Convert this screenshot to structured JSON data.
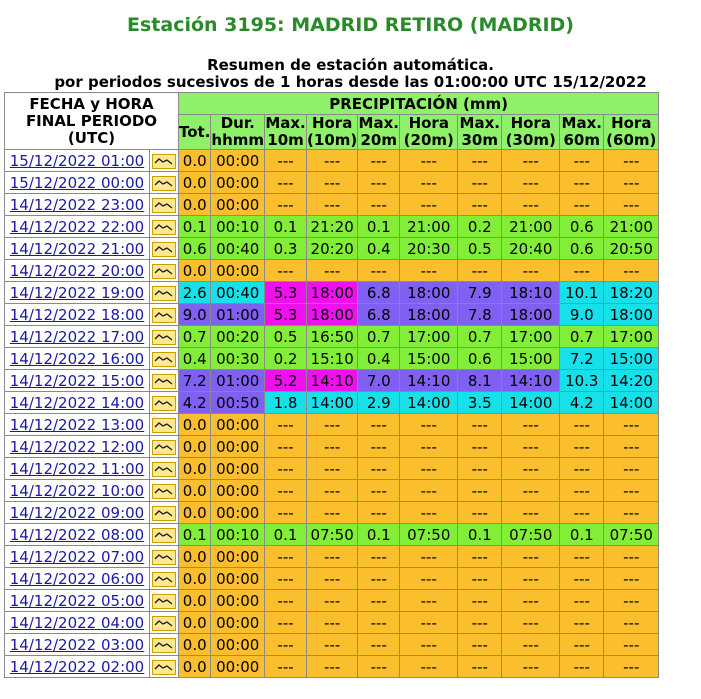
{
  "title": "Estación 3195: MADRID RETIRO (MADRID)",
  "subtitle1": "Resumen de estación automática.",
  "subtitle2": "por periodos sucesivos de 1 horas desde las 01:00:00 UTC 15/12/2022",
  "headers": {
    "fecha": "FECHA y HORA FINAL PERIODO (UTC)",
    "precip": "PRECIPITACIÓN (mm)",
    "cols": [
      "Tot.",
      "Dur. hhmm",
      "Max. 10m",
      "Hora (10m)",
      "Max. 20m",
      "Hora (20m)",
      "Max. 30m",
      "Hora (30m)",
      "Max. 60m",
      "Hora (60m)"
    ]
  },
  "icon": "graph-icon",
  "colors": {
    "orange": "#fbbf2e",
    "green": "#82ee38",
    "cyan": "#17e0e8",
    "blue": "#8060f0",
    "magenta": "#ee11ee",
    "header": "#8ff06a",
    "title": "#2a8a2a"
  },
  "rows": [
    {
      "date": "15/12/2022 01:00",
      "v": [
        "0.0",
        "00:00",
        "---",
        "---",
        "---",
        "---",
        "---",
        "---",
        "---",
        "---"
      ],
      "c": [
        "or",
        "or",
        "or",
        "or",
        "or",
        "or",
        "or",
        "or",
        "or",
        "or"
      ]
    },
    {
      "date": "15/12/2022 00:00",
      "v": [
        "0.0",
        "00:00",
        "---",
        "---",
        "---",
        "---",
        "---",
        "---",
        "---",
        "---"
      ],
      "c": [
        "or",
        "or",
        "or",
        "or",
        "or",
        "or",
        "or",
        "or",
        "or",
        "or"
      ]
    },
    {
      "date": "14/12/2022 23:00",
      "v": [
        "0.0",
        "00:00",
        "---",
        "---",
        "---",
        "---",
        "---",
        "---",
        "---",
        "---"
      ],
      "c": [
        "or",
        "or",
        "or",
        "or",
        "or",
        "or",
        "or",
        "or",
        "or",
        "or"
      ]
    },
    {
      "date": "14/12/2022 22:00",
      "v": [
        "0.1",
        "00:10",
        "0.1",
        "21:20",
        "0.1",
        "21:00",
        "0.2",
        "21:00",
        "0.6",
        "21:00"
      ],
      "c": [
        "gr",
        "gr",
        "gr",
        "gr",
        "gr",
        "gr",
        "gr",
        "gr",
        "gr",
        "gr"
      ]
    },
    {
      "date": "14/12/2022 21:00",
      "v": [
        "0.6",
        "00:40",
        "0.3",
        "20:20",
        "0.4",
        "20:30",
        "0.5",
        "20:40",
        "0.6",
        "20:50"
      ],
      "c": [
        "gr",
        "gr",
        "gr",
        "gr",
        "gr",
        "gr",
        "gr",
        "gr",
        "gr",
        "gr"
      ]
    },
    {
      "date": "14/12/2022 20:00",
      "v": [
        "0.0",
        "00:00",
        "---",
        "---",
        "---",
        "---",
        "---",
        "---",
        "---",
        "---"
      ],
      "c": [
        "or",
        "or",
        "or",
        "or",
        "or",
        "or",
        "or",
        "or",
        "or",
        "or"
      ]
    },
    {
      "date": "14/12/2022 19:00",
      "v": [
        "2.6",
        "00:40",
        "5.3",
        "18:00",
        "6.8",
        "18:00",
        "7.9",
        "18:10",
        "10.1",
        "18:20"
      ],
      "c": [
        "cy",
        "cy",
        "mg",
        "mg",
        "bl",
        "bl",
        "bl",
        "bl",
        "cy",
        "cy"
      ]
    },
    {
      "date": "14/12/2022 18:00",
      "v": [
        "9.0",
        "01:00",
        "5.3",
        "18:00",
        "6.8",
        "18:00",
        "7.8",
        "18:00",
        "9.0",
        "18:00"
      ],
      "c": [
        "bl",
        "bl",
        "mg",
        "mg",
        "bl",
        "bl",
        "bl",
        "bl",
        "cy",
        "cy"
      ]
    },
    {
      "date": "14/12/2022 17:00",
      "v": [
        "0.7",
        "00:20",
        "0.5",
        "16:50",
        "0.7",
        "17:00",
        "0.7",
        "17:00",
        "0.7",
        "17:00"
      ],
      "c": [
        "gr",
        "gr",
        "gr",
        "gr",
        "gr",
        "gr",
        "gr",
        "gr",
        "gr",
        "gr"
      ]
    },
    {
      "date": "14/12/2022 16:00",
      "v": [
        "0.4",
        "00:30",
        "0.2",
        "15:10",
        "0.4",
        "15:00",
        "0.6",
        "15:00",
        "7.2",
        "15:00"
      ],
      "c": [
        "gr",
        "gr",
        "gr",
        "gr",
        "gr",
        "gr",
        "gr",
        "gr",
        "cy",
        "cy"
      ]
    },
    {
      "date": "14/12/2022 15:00",
      "v": [
        "7.2",
        "01:00",
        "5.2",
        "14:10",
        "7.0",
        "14:10",
        "8.1",
        "14:10",
        "10.3",
        "14:20"
      ],
      "c": [
        "bl",
        "bl",
        "mg",
        "mg",
        "bl",
        "bl",
        "bl",
        "bl",
        "cy",
        "cy"
      ]
    },
    {
      "date": "14/12/2022 14:00",
      "v": [
        "4.2",
        "00:50",
        "1.8",
        "14:00",
        "2.9",
        "14:00",
        "3.5",
        "14:00",
        "4.2",
        "14:00"
      ],
      "c": [
        "bl",
        "bl",
        "cy",
        "cy",
        "cy",
        "cy",
        "cy",
        "cy",
        "cy",
        "cy"
      ]
    },
    {
      "date": "14/12/2022 13:00",
      "v": [
        "0.0",
        "00:00",
        "---",
        "---",
        "---",
        "---",
        "---",
        "---",
        "---",
        "---"
      ],
      "c": [
        "or",
        "or",
        "or",
        "or",
        "or",
        "or",
        "or",
        "or",
        "or",
        "or"
      ]
    },
    {
      "date": "14/12/2022 12:00",
      "v": [
        "0.0",
        "00:00",
        "---",
        "---",
        "---",
        "---",
        "---",
        "---",
        "---",
        "---"
      ],
      "c": [
        "or",
        "or",
        "or",
        "or",
        "or",
        "or",
        "or",
        "or",
        "or",
        "or"
      ]
    },
    {
      "date": "14/12/2022 11:00",
      "v": [
        "0.0",
        "00:00",
        "---",
        "---",
        "---",
        "---",
        "---",
        "---",
        "---",
        "---"
      ],
      "c": [
        "or",
        "or",
        "or",
        "or",
        "or",
        "or",
        "or",
        "or",
        "or",
        "or"
      ]
    },
    {
      "date": "14/12/2022 10:00",
      "v": [
        "0.0",
        "00:00",
        "---",
        "---",
        "---",
        "---",
        "---",
        "---",
        "---",
        "---"
      ],
      "c": [
        "or",
        "or",
        "or",
        "or",
        "or",
        "or",
        "or",
        "or",
        "or",
        "or"
      ]
    },
    {
      "date": "14/12/2022 09:00",
      "v": [
        "0.0",
        "00:00",
        "---",
        "---",
        "---",
        "---",
        "---",
        "---",
        "---",
        "---"
      ],
      "c": [
        "or",
        "or",
        "or",
        "or",
        "or",
        "or",
        "or",
        "or",
        "or",
        "or"
      ]
    },
    {
      "date": "14/12/2022 08:00",
      "v": [
        "0.1",
        "00:10",
        "0.1",
        "07:50",
        "0.1",
        "07:50",
        "0.1",
        "07:50",
        "0.1",
        "07:50"
      ],
      "c": [
        "gr",
        "gr",
        "gr",
        "gr",
        "gr",
        "gr",
        "gr",
        "gr",
        "gr",
        "gr"
      ]
    },
    {
      "date": "14/12/2022 07:00",
      "v": [
        "0.0",
        "00:00",
        "---",
        "---",
        "---",
        "---",
        "---",
        "---",
        "---",
        "---"
      ],
      "c": [
        "or",
        "or",
        "or",
        "or",
        "or",
        "or",
        "or",
        "or",
        "or",
        "or"
      ]
    },
    {
      "date": "14/12/2022 06:00",
      "v": [
        "0.0",
        "00:00",
        "---",
        "---",
        "---",
        "---",
        "---",
        "---",
        "---",
        "---"
      ],
      "c": [
        "or",
        "or",
        "or",
        "or",
        "or",
        "or",
        "or",
        "or",
        "or",
        "or"
      ]
    },
    {
      "date": "14/12/2022 05:00",
      "v": [
        "0.0",
        "00:00",
        "---",
        "---",
        "---",
        "---",
        "---",
        "---",
        "---",
        "---"
      ],
      "c": [
        "or",
        "or",
        "or",
        "or",
        "or",
        "or",
        "or",
        "or",
        "or",
        "or"
      ]
    },
    {
      "date": "14/12/2022 04:00",
      "v": [
        "0.0",
        "00:00",
        "---",
        "---",
        "---",
        "---",
        "---",
        "---",
        "---",
        "---"
      ],
      "c": [
        "or",
        "or",
        "or",
        "or",
        "or",
        "or",
        "or",
        "or",
        "or",
        "or"
      ]
    },
    {
      "date": "14/12/2022 03:00",
      "v": [
        "0.0",
        "00:00",
        "---",
        "---",
        "---",
        "---",
        "---",
        "---",
        "---",
        "---"
      ],
      "c": [
        "or",
        "or",
        "or",
        "or",
        "or",
        "or",
        "or",
        "or",
        "or",
        "or"
      ]
    },
    {
      "date": "14/12/2022 02:00",
      "v": [
        "0.0",
        "00:00",
        "---",
        "---",
        "---",
        "---",
        "---",
        "---",
        "---",
        "---"
      ],
      "c": [
        "or",
        "or",
        "or",
        "or",
        "or",
        "or",
        "or",
        "or",
        "or",
        "or"
      ]
    }
  ]
}
